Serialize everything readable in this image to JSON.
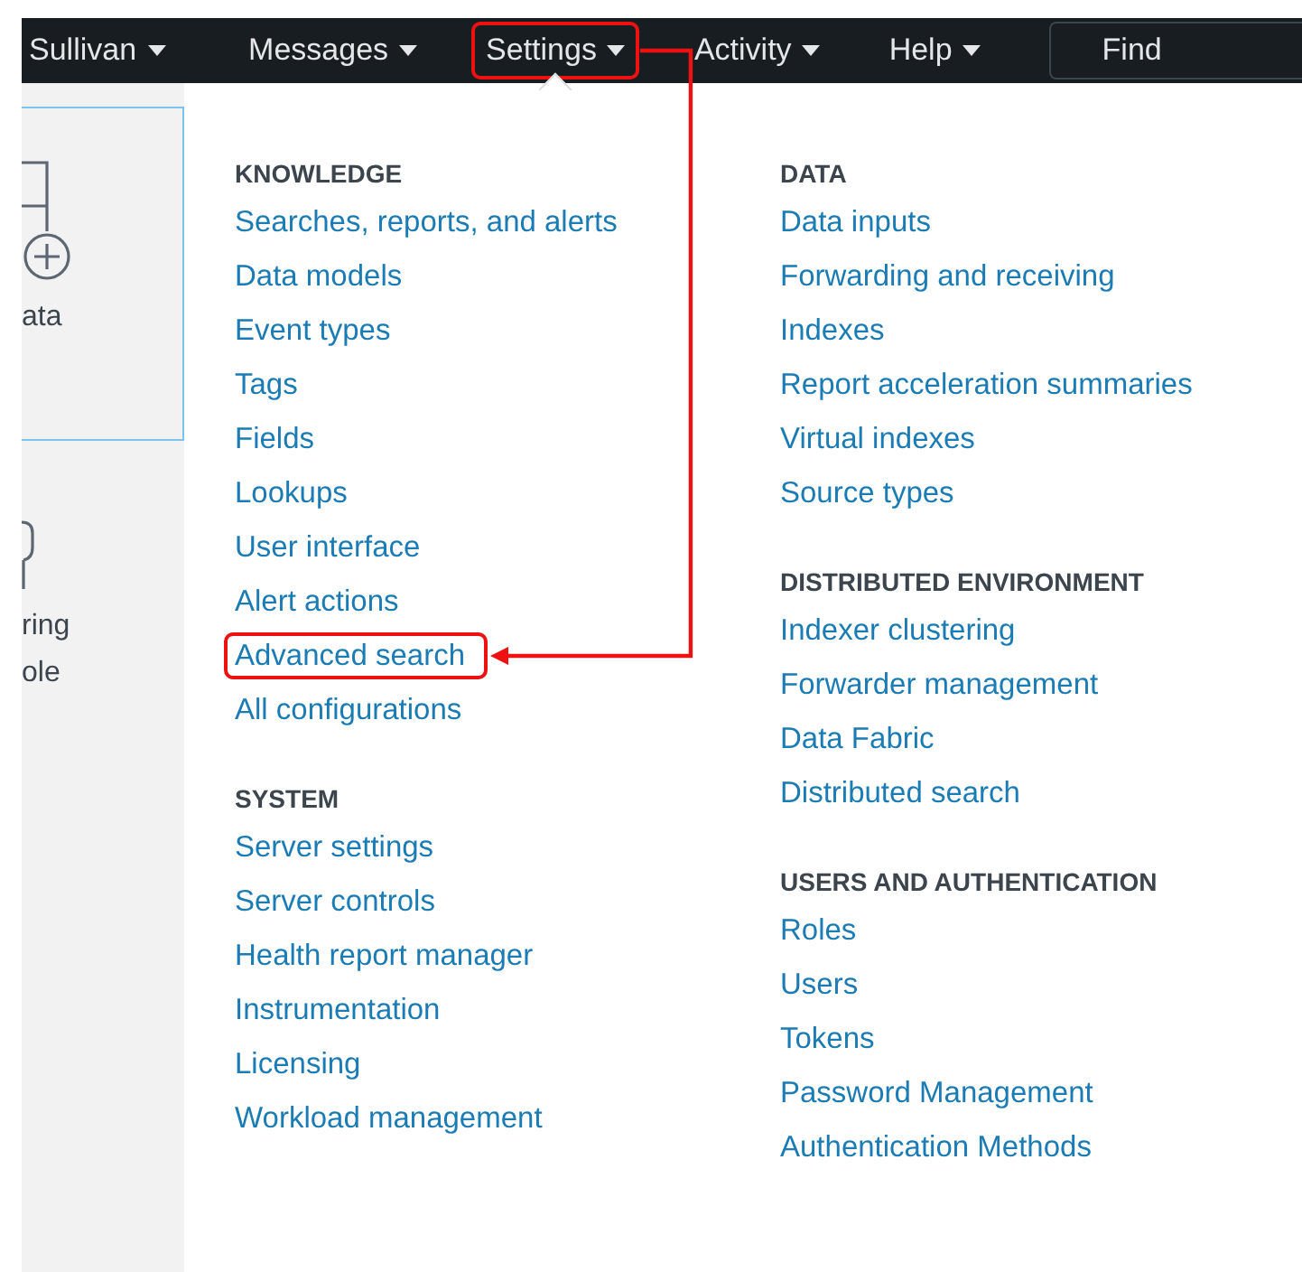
{
  "nav": {
    "items": [
      {
        "label": "Sullivan",
        "selected": false,
        "highlighted": false
      },
      {
        "label": "Messages",
        "selected": false,
        "highlighted": false
      },
      {
        "label": "Settings",
        "selected": true,
        "highlighted": true
      },
      {
        "label": "Activity",
        "selected": false,
        "highlighted": false
      },
      {
        "label": "Help",
        "selected": false,
        "highlighted": false
      }
    ],
    "search": {
      "placeholder": "Find"
    }
  },
  "side_panel": {
    "cards": [
      {
        "lines": [
          "ata"
        ],
        "selected": true
      },
      {
        "lines": [
          "ring",
          "ole"
        ],
        "selected": false
      }
    ]
  },
  "menu": {
    "columns": [
      {
        "sections": [
          {
            "heading": "KNOWLEDGE",
            "items": [
              {
                "label": "Searches, reports, and alerts",
                "highlighted": false
              },
              {
                "label": "Data models",
                "highlighted": false
              },
              {
                "label": "Event types",
                "highlighted": false
              },
              {
                "label": "Tags",
                "highlighted": false
              },
              {
                "label": "Fields",
                "highlighted": false
              },
              {
                "label": "Lookups",
                "highlighted": false
              },
              {
                "label": "User interface",
                "highlighted": false
              },
              {
                "label": "Alert actions",
                "highlighted": false
              },
              {
                "label": "Advanced search",
                "highlighted": true
              },
              {
                "label": "All configurations",
                "highlighted": false
              }
            ]
          },
          {
            "heading": "SYSTEM",
            "items": [
              {
                "label": "Server settings",
                "highlighted": false
              },
              {
                "label": "Server controls",
                "highlighted": false
              },
              {
                "label": "Health report manager",
                "highlighted": false
              },
              {
                "label": "Instrumentation",
                "highlighted": false
              },
              {
                "label": "Licensing",
                "highlighted": false
              },
              {
                "label": "Workload management",
                "highlighted": false
              }
            ]
          }
        ]
      },
      {
        "sections": [
          {
            "heading": "DATA",
            "items": [
              {
                "label": "Data inputs",
                "highlighted": false
              },
              {
                "label": "Forwarding and receiving",
                "highlighted": false
              },
              {
                "label": "Indexes",
                "highlighted": false
              },
              {
                "label": "Report acceleration summaries",
                "highlighted": false
              },
              {
                "label": "Virtual indexes",
                "highlighted": false
              },
              {
                "label": "Source types",
                "highlighted": false
              }
            ]
          },
          {
            "heading": "DISTRIBUTED ENVIRONMENT",
            "items": [
              {
                "label": "Indexer clustering",
                "highlighted": false
              },
              {
                "label": "Forwarder management",
                "highlighted": false
              },
              {
                "label": "Data Fabric",
                "highlighted": false
              },
              {
                "label": "Distributed search",
                "highlighted": false
              }
            ]
          },
          {
            "heading": "USERS AND AUTHENTICATION",
            "items": [
              {
                "label": "Roles",
                "highlighted": false
              },
              {
                "label": "Users",
                "highlighted": false
              },
              {
                "label": "Tokens",
                "highlighted": false
              },
              {
                "label": "Password Management",
                "highlighted": false
              },
              {
                "label": "Authentication Methods",
                "highlighted": false
              }
            ]
          }
        ]
      }
    ]
  }
}
